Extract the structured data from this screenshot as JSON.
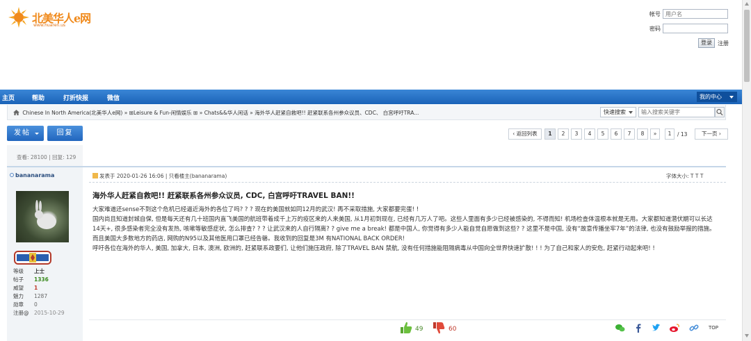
{
  "header": {
    "logo_text": "北美华人e网",
    "logo_url": "www.huaren.us",
    "username_label": "帐号",
    "username_placeholder": "用户名",
    "password_label": "密码",
    "login_button": "登录",
    "register_link": "注册"
  },
  "nav": {
    "items": [
      "主页",
      "帮助",
      "打折快报",
      "微信"
    ],
    "my_center": "我的中心"
  },
  "breadcrumb": {
    "text": "Chinese In North America(北美华人e网) » ⊞Leisure & Fun-闲情娱乐 ⊞ » Chats&&华人闲话 » 海外华人赶紧自救吧!! 赶紧联系各州参众议员、CDC、 白宫呼吁TRA...",
    "quick_search": "快速搜索",
    "search_placeholder": "输入搜索关键字"
  },
  "actions": {
    "post_button": "发帖",
    "reply_button": "回复"
  },
  "pagination": {
    "back": "‹ 返回列表",
    "pages": [
      "1",
      "2",
      "3",
      "4",
      "5",
      "6",
      "7",
      "8"
    ],
    "more": "»",
    "current_input": "1",
    "total": "/ 13",
    "next": "下一页 ›"
  },
  "stats": {
    "text": "查看: 28100 | 回复: 129"
  },
  "post": {
    "author": "bananarama",
    "meta": "发表于 2020-01-26 16:06 | 只看楼主(bananarama)",
    "font_size": "字体大小: T T T",
    "title": "海外华人赶紧自救吧!! 赶紧联系各州参众议员, CDC, 白宫呼吁TRAVEL BAN!!",
    "body": [
      "大家难道还sense不到这个危机已经逼近海外的各位了吗? ? ? 现在的美国就如同12月的武汉! 再不采取措施, 大家都要完蛋! !",
      "国内尚且知道封城自保, 但是每天还有几十班国内直飞美国的航班带着成千上万的疫区来的人来美国, 从1月初到现在, 已经有几万人了吧。这些人里面有多少已经被感染的, 不得而知! 机场检查体温根本就是无用。大家都知道潜伏期可以长达14天+, 很多感染者完全没有发热, 咳嗽等敏感症状, 怎么排查? ? ? 让武汉来的人自行隔离? ? give me a break! 都是中国人, 你觉得有多少人能自觉自愿做到这些? ? 这里不是中国, 没有“故意传播坐牢7年”的法律, 也没有鼓励举报的措施。而且美国大多数地方的药店, 网购的N95以及其他医用口罩已经告罄。我收到的回复是3M 有NATIONAL BACK ORDER!",
      "呼吁各位在海外的华人, 美国, 加拿大, 日本, 澳洲, 欧洲的, 赶紧联系政要们, 让他们施压政府, 除了TRAVEL BAN 禁航, 没有任何措施能阻隔病毒从中国向全世界快速扩散! ! ! 为了自己和家人的安危, 赶紧行动起来吧! !"
    ],
    "likes": "49",
    "dislikes": "60",
    "top_link": "TOP"
  },
  "user_stats": [
    {
      "k": "等级",
      "v": "上士",
      "color": "#333333",
      "bold": true
    },
    {
      "k": "帖子",
      "v": "1336",
      "color": "#3a8a1e",
      "bold": true
    },
    {
      "k": "威望",
      "v": "1",
      "color": "#c0392b",
      "bold": true
    },
    {
      "k": "魅力",
      "v": "1287",
      "color": "#666666",
      "bold": false
    },
    {
      "k": "勋章",
      "v": "0",
      "color": "#666666",
      "bold": false
    },
    {
      "k": "注册@",
      "v": "2015-10-29",
      "color": "#888888",
      "bold": false
    }
  ],
  "colors": {
    "nav_blue": "#1b63b8",
    "like_green": "#4a8a2a",
    "dislike_red": "#c0392b"
  }
}
